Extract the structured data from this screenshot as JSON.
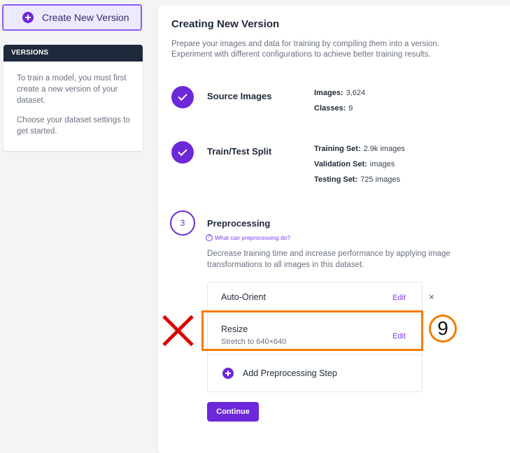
{
  "sidebar": {
    "create_button": "Create New Version",
    "versions_header": "VERSIONS",
    "versions_text": [
      "To train a model, you must first create a new version of your dataset.",
      "Choose your dataset settings to get started."
    ]
  },
  "main": {
    "title": "Creating New Version",
    "description": "Prepare your images and data for training by compiling them into a version. Experiment with different configurations to achieve better training results.",
    "steps": {
      "source": {
        "title": "Source Images",
        "images_label": "Images:",
        "images_value": "3,624",
        "classes_label": "Classes:",
        "classes_value": "9"
      },
      "split": {
        "title": "Train/Test Split",
        "training_label": "Training Set:",
        "training_value": "2.9k images",
        "validation_label": "Validation Set:",
        "validation_value": "images",
        "testing_label": "Testing Set:",
        "testing_value": "725 images"
      },
      "preprocessing": {
        "number": "3",
        "title": "Preprocessing",
        "help_link": "What can preprocessing do?",
        "help_icon_glyph": "?",
        "description": "Decrease training time and increase performance by applying image transformations to all images in this dataset.",
        "items": [
          {
            "title": "Auto-Orient",
            "edit": "Edit"
          },
          {
            "title": "Resize",
            "subtitle": "Stretch to 640×640",
            "edit": "Edit"
          }
        ],
        "add_step": "Add Preprocessing Step",
        "remove_glyph": "×"
      }
    },
    "continue_button": "Continue"
  },
  "annotation": {
    "step_number": "9",
    "highlight_color": "#f57c00",
    "cross_color": "#e00000"
  },
  "colors": {
    "accent": "#6d28d9",
    "link": "#7c3aed",
    "header_dark": "#1e293b"
  }
}
